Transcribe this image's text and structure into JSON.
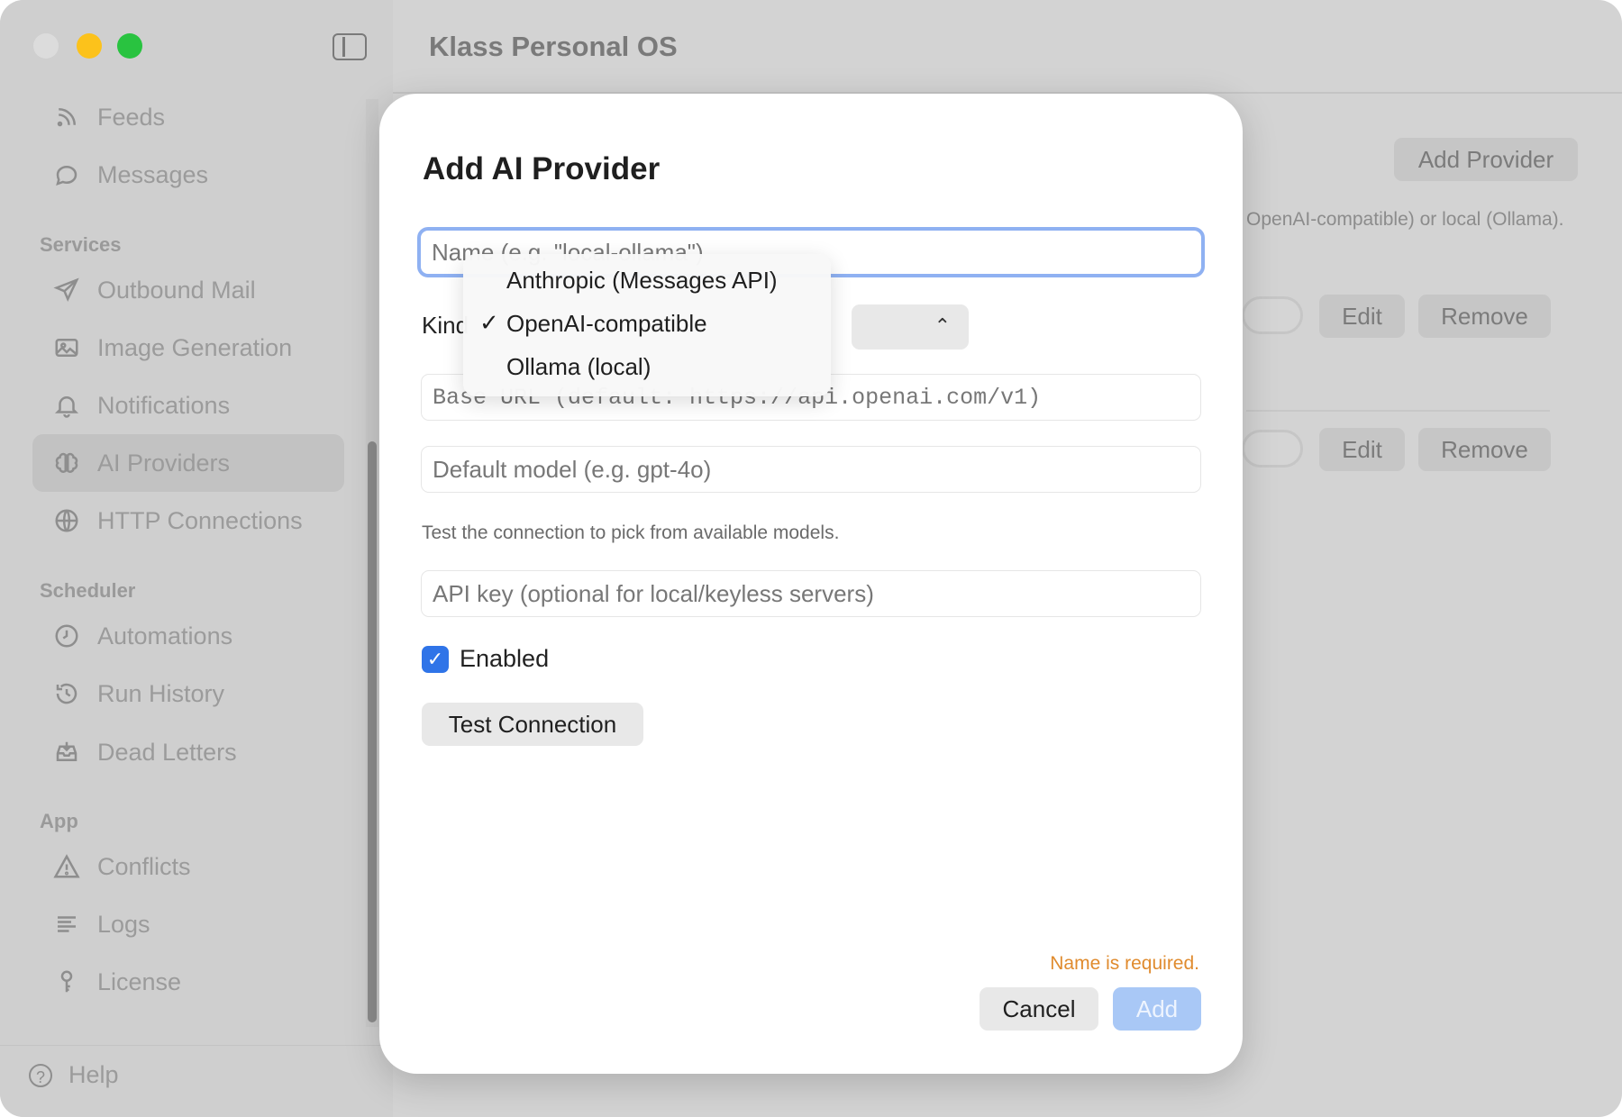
{
  "window": {
    "title": "Klass Personal OS"
  },
  "sidebar": {
    "items_top": [
      {
        "label": "Feeds",
        "icon": "feeds-icon"
      },
      {
        "label": "Messages",
        "icon": "messages-icon"
      }
    ],
    "sections": [
      {
        "title": "Services",
        "items": [
          {
            "label": "Outbound Mail",
            "icon": "send-icon"
          },
          {
            "label": "Image Generation",
            "icon": "image-icon"
          },
          {
            "label": "Notifications",
            "icon": "bell-icon"
          },
          {
            "label": "AI Providers",
            "icon": "brain-icon",
            "active": true
          },
          {
            "label": "HTTP Connections",
            "icon": "globe-icon"
          }
        ]
      },
      {
        "title": "Scheduler",
        "items": [
          {
            "label": "Automations",
            "icon": "clock-icon"
          },
          {
            "label": "Run History",
            "icon": "history-icon"
          },
          {
            "label": "Dead Letters",
            "icon": "tray-icon"
          }
        ]
      },
      {
        "title": "App",
        "items": [
          {
            "label": "Conflicts",
            "icon": "warning-icon"
          },
          {
            "label": "Logs",
            "icon": "lines-icon"
          },
          {
            "label": "License",
            "icon": "key-icon"
          }
        ]
      }
    ],
    "help_label": "Help"
  },
  "background": {
    "add_provider_label": "Add Provider",
    "description_fragment": "OpenAI-compatible) or local (Ollama).",
    "rows": [
      {
        "edit_label": "Edit",
        "remove_label": "Remove"
      },
      {
        "edit_label": "Edit",
        "remove_label": "Remove"
      }
    ]
  },
  "modal": {
    "title": "Add AI Provider",
    "name_placeholder": "Name (e.g. \"local-ollama\")",
    "kind_label": "Kind",
    "kind_selected": "OpenAI-compatible",
    "kind_options": [
      "Anthropic (Messages API)",
      "OpenAI-compatible",
      "Ollama (local)"
    ],
    "base_url_placeholder": "Base URL (default: https://api.openai.com/v1)",
    "default_model_placeholder": "Default model (e.g. gpt-4o)",
    "hint": "Test the connection to pick from available models.",
    "api_key_placeholder": "API key (optional for local/keyless servers)",
    "enabled_label": "Enabled",
    "enabled": true,
    "test_connection_label": "Test Connection",
    "error_text": "Name is required.",
    "cancel_label": "Cancel",
    "add_label": "Add",
    "checkmark": "✓"
  },
  "colors": {
    "accent": "#2f74e8",
    "focus_ring": "#8fb1f2",
    "error": "#e08b2e",
    "add_disabled": "#a9c8f6"
  }
}
